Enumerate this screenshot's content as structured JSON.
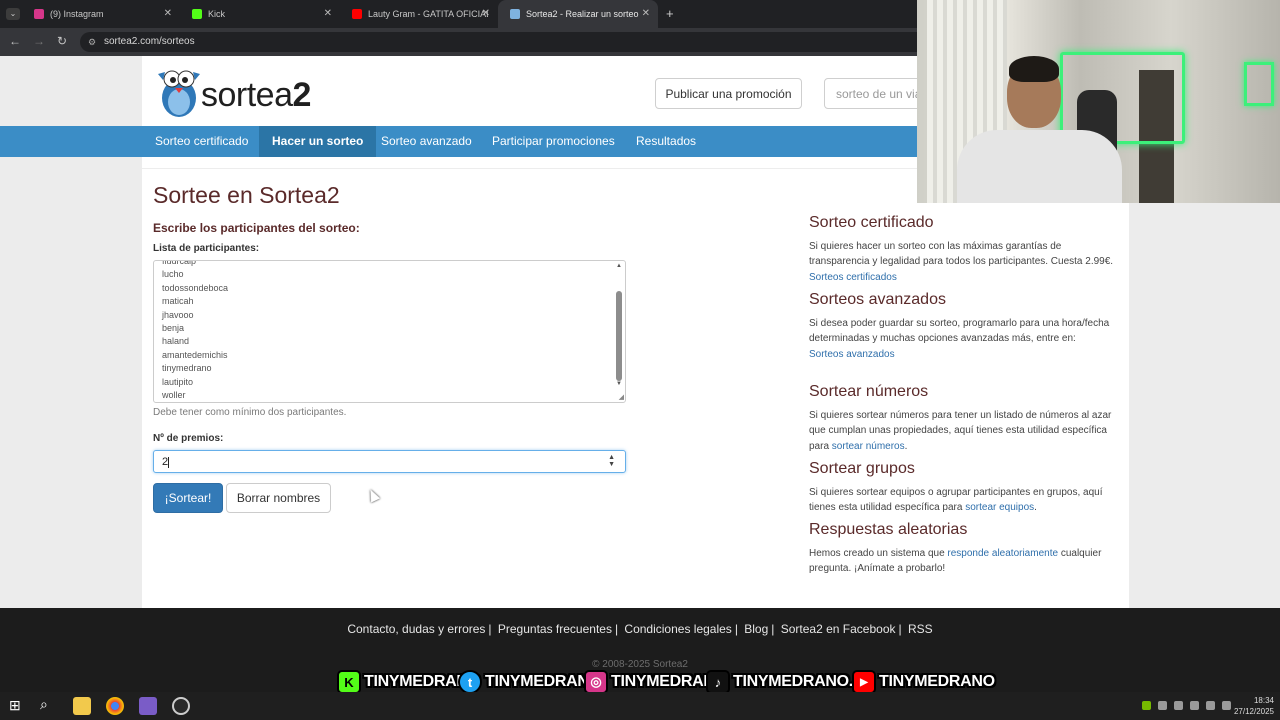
{
  "browser": {
    "tabs": [
      {
        "title": "(9) Instagram",
        "color": "#d6368a",
        "active": false
      },
      {
        "title": "Kick",
        "color": "#53fc18",
        "active": false
      },
      {
        "title": "Lauty Gram - GATITA OFICIAL (",
        "color": "#ff0000",
        "active": false
      },
      {
        "title": "Sortea2 - Realizar un sorteo",
        "color": "#7fb3e0",
        "active": true
      }
    ],
    "new_tab": "+",
    "url": "sortea2.com/sorteos"
  },
  "header": {
    "logo_text_a": "sortea",
    "logo_text_b": "2",
    "publish_button": "Publicar una promoción",
    "search_placeholder": "sorteo de un viaj"
  },
  "nav": {
    "items": [
      {
        "label": "Sorteo certificado"
      },
      {
        "label": "Hacer un sorteo"
      },
      {
        "label": "Sorteo avanzado"
      },
      {
        "label": "Participar promociones"
      },
      {
        "label": "Resultados"
      }
    ]
  },
  "main": {
    "title": "Sortee en Sortea2",
    "subtitle": "Escribe los participantes del sorteo:",
    "list_label": "Lista de participantes:",
    "participants": [
      "fludrcalp",
      "lucho",
      "todossondeboca",
      "maticah",
      "jhavooo",
      "benja",
      "haland",
      "amantedemichis",
      "tinymedrano",
      "lautipito",
      "woller"
    ],
    "min_note": "Debe tener como mínimo dos participantes.",
    "prizes_label": "Nº de premios:",
    "prizes_value": "2",
    "draw_button": "¡Sortear!",
    "clear_button": "Borrar nombres"
  },
  "sidebar": {
    "sections": [
      {
        "title": "Sorteo certificado",
        "text": "Si quieres hacer un sorteo con las máximas garantías de transparencia y legalidad para todos los participantes. Cuesta 2.99€. ",
        "link": "Sorteos certificados",
        "after": ""
      },
      {
        "title": "Sorteos avanzados",
        "text": "Si desea poder guardar su sorteo, programarlo para una hora/fecha determinadas y muchas opciones avanzadas más, entre en: ",
        "link": "Sorteos avanzados",
        "after": ""
      },
      {
        "title": "Sortear números",
        "text": "Si quieres sortear números para tener un listado de números al azar que cumplan unas propiedades, aquí tienes esta utilidad específica para ",
        "link": "sortear números",
        "after": "."
      },
      {
        "title": "Sortear grupos",
        "text": "Si quieres sortear equipos o agrupar participantes en grupos, aquí tienes esta utilidad específica para ",
        "link": "sortear equipos",
        "after": "."
      },
      {
        "title": "Respuestas aleatorias",
        "text": "Hemos creado un sistema que ",
        "link": "responde aleatoriamente",
        "after": " cualquier pregunta. ¡Anímate a probarlo!"
      }
    ]
  },
  "footer": {
    "links": [
      "Contacto, dudas y errores",
      "Preguntas frecuentes",
      "Condiciones legales",
      "Blog",
      "Sortea2 en Facebook",
      "RSS"
    ],
    "copyright": "© 2008-2025 Sortea2"
  },
  "overlay": {
    "items": [
      {
        "icon": "K",
        "color": "#53fc18",
        "text": "TINYMEDRANO"
      },
      {
        "icon": "t",
        "color": "#1da1f2",
        "text": "TINYMEDRANO"
      },
      {
        "icon": "◎",
        "color": "#d6368a",
        "text": "TINYMEDRANO"
      },
      {
        "icon": "♪",
        "color": "#111111",
        "text": "TINYMEDRANO.JR"
      },
      {
        "icon": "▶",
        "color": "#ff0000",
        "text": "TINYMEDRANO"
      }
    ]
  },
  "taskbar": {
    "time": "18:34",
    "date": "27/12/2025"
  },
  "colors": {
    "nav_blue": "#3b8dc6",
    "primary_button": "#337ab7",
    "heading_brown": "#5a2a2a"
  }
}
